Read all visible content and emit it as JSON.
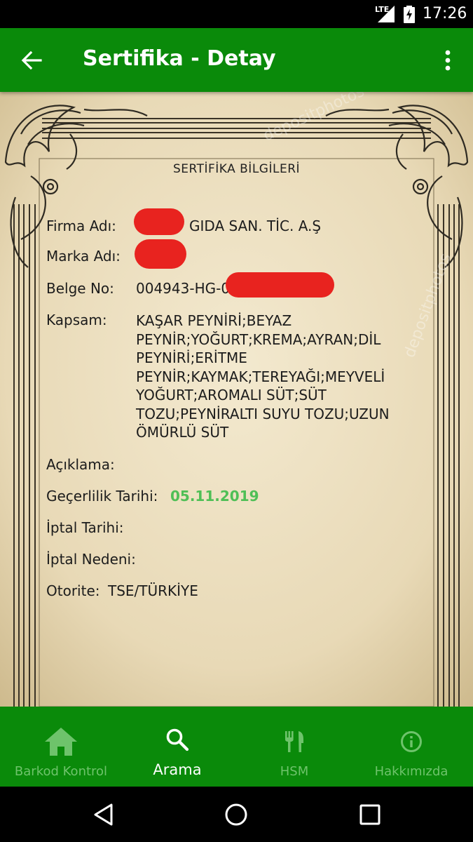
{
  "status_bar": {
    "network": "LTE",
    "time": "17:26"
  },
  "app_bar": {
    "title": "Sertifika - Detay"
  },
  "certificate": {
    "heading": "SERTİFİKA BİLGİLERİ",
    "fields": {
      "firma_label": "Firma Adı:",
      "firma_value": "GIDA SAN. TİC. A.Ş",
      "marka_label": "Marka Adı:",
      "belge_label": "Belge No:",
      "belge_value": "004943-HG-0",
      "kapsam_label": "Kapsam:",
      "kapsam_value": "KAŞAR PEYNİRİ;BEYAZ PEYNİR;YOĞURT;KREMA;AYRAN;DİL PEYNİRİ;ERİTME PEYNİR;KAYMAK;TEREYAĞI;MEYVELİ YOĞURT;AROMALI SÜT;SÜT TOZU;PEYNİRALTI SUYU TOZU;UZUN ÖMÜRLÜ SÜT",
      "aciklama_label": "Açıklama:",
      "gecerlilik_label": "Geçerlilik Tarihi:",
      "gecerlilik_value": "05.11.2019",
      "iptal_tarihi_label": "İptal Tarihi:",
      "iptal_nedeni_label": "İptal Nedeni:",
      "otorite_label": "Otorite:",
      "otorite_value": "TSE/TÜRKİYE"
    },
    "colors": {
      "date_value": "#4fbf56",
      "redaction": "#e8231f"
    }
  },
  "bottom_nav": {
    "items": [
      {
        "label": "Barkod Kontrol",
        "icon": "home-icon",
        "active": false
      },
      {
        "label": "Arama",
        "icon": "search-icon",
        "active": true
      },
      {
        "label": "HSM",
        "icon": "restaurant-icon",
        "active": false
      },
      {
        "label": "Hakkımızda",
        "icon": "info-icon",
        "active": false
      }
    ]
  },
  "theme": {
    "primary": "#0a8a0a",
    "inactive_nav": "#6ec36b",
    "paper": "#ece0c2"
  }
}
